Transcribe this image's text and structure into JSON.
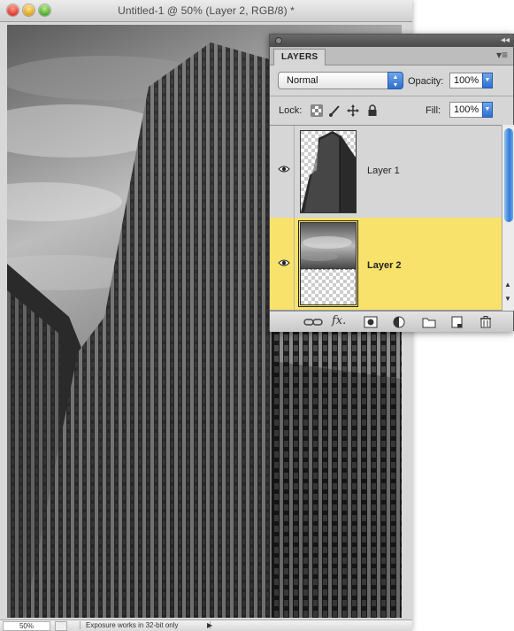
{
  "window": {
    "title": "Untitled-1 @ 50% (Layer 2, RGB/8) *"
  },
  "statusbar": {
    "zoom": "50%",
    "message": "Exposure works in 32-bit only"
  },
  "layers_panel": {
    "tab_label": "LAYERS",
    "blend_mode": "Normal",
    "opacity_label": "Opacity:",
    "opacity_value": "100%",
    "lock_label": "Lock:",
    "fill_label": "Fill:",
    "fill_value": "100%",
    "layers": [
      {
        "name": "Layer 1",
        "visible": true,
        "selected": false
      },
      {
        "name": "Layer 2",
        "visible": true,
        "selected": true
      }
    ],
    "footer_icons": [
      "link-layers-icon",
      "layer-style-fx-icon",
      "add-mask-icon",
      "adjustment-layer-icon",
      "new-group-folder-icon",
      "new-layer-icon",
      "trash-icon"
    ]
  },
  "colors": {
    "selected_row": "#f8e26b",
    "scroll_accent": "#2f7ad8"
  }
}
